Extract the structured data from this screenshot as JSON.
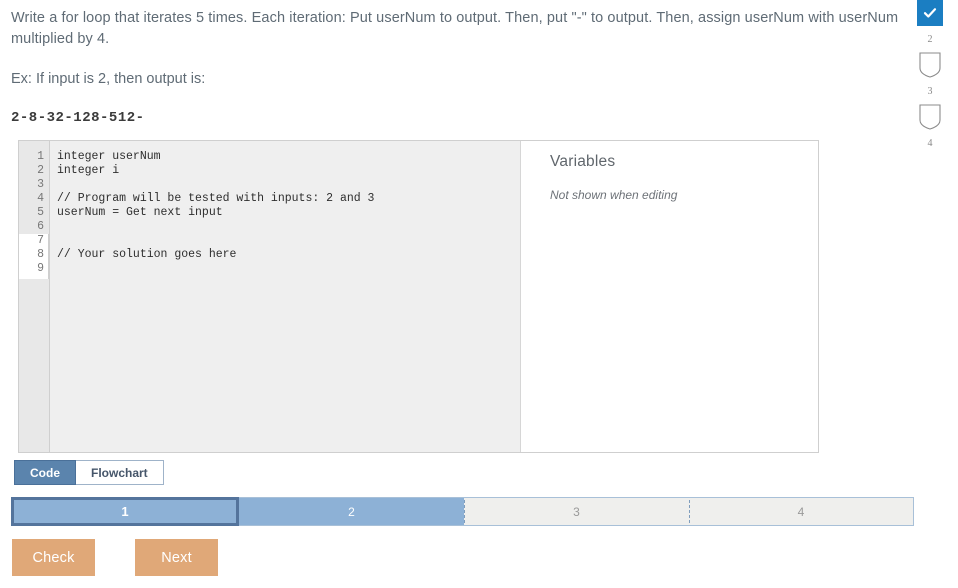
{
  "prompt": {
    "line1": "Write a for loop that iterates 5 times. Each iteration: Put userNum to output. Then, put \"-\" to output. Then, assign userNum with userNum multiplied by 4.",
    "example_label": "Ex: If input is 2, then output is:",
    "example_output": "2-8-32-128-512-"
  },
  "rail": {
    "items": [
      {
        "state": "complete",
        "icon": "check-icon",
        "label": ""
      },
      {
        "state": "pending",
        "icon": "shield-icon",
        "label": "2"
      },
      {
        "state": "pending",
        "icon": "shield-icon",
        "label": "3"
      },
      {
        "state": "pending",
        "icon": "shield-icon",
        "label": "4"
      }
    ],
    "check_color": "#1b7ec2",
    "shield_outline_color": "#8b8b8b"
  },
  "editor": {
    "line_numbers": [
      "1",
      "2",
      "3",
      "4",
      "5",
      "6",
      "7",
      "8",
      "9"
    ],
    "code": [
      "integer userNum",
      "integer i",
      "",
      "// Program will be tested with inputs: 2 and 3",
      "userNum = Get next input",
      "",
      "",
      "// Your solution goes here",
      ""
    ]
  },
  "variables": {
    "title": "Variables",
    "note": "Not shown when editing"
  },
  "tabs": {
    "code_label": "Code",
    "flowchart_label": "Flowchart",
    "active": "Code",
    "active_color": "#5b84ad"
  },
  "progress": {
    "segments": [
      {
        "label": "1",
        "state": "current"
      },
      {
        "label": "2",
        "state": "done"
      },
      {
        "label": "3",
        "state": "todo"
      },
      {
        "label": "4",
        "state": "todo"
      }
    ],
    "done_color": "#8db1d6",
    "todo_color": "#efefed",
    "current_border_color": "#54749c"
  },
  "actions": {
    "check_label": "Check",
    "next_label": "Next",
    "button_color": "#e0a878"
  }
}
